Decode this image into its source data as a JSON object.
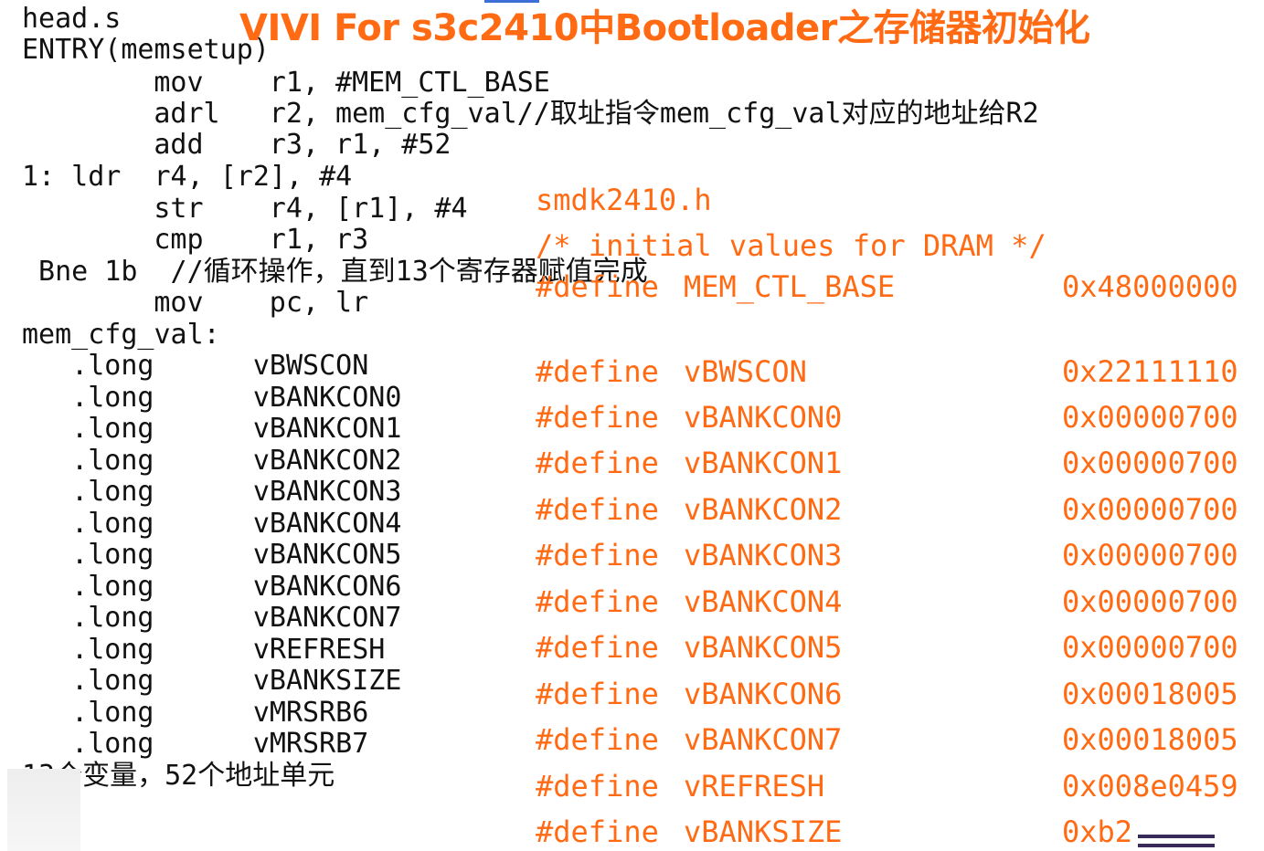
{
  "title": "VIVI For s3c2410中Bootloader之存储器初始化",
  "code_lines": [
    "head.s",
    "ENTRY(memsetup)",
    "      mov    r1, #MEM_CTL_BASE",
    "      adrl   r2, mem_cfg_val//取址指令mem_cfg_val对应的地址给R2",
    "      add    r3, r1, #52",
    "1: ldr  r4, [r2], #4",
    "      str    r4, [r1], #4",
    "      cmp    r1, r3",
    " Bne 1b  //循环操作，直到13个寄存器赋值完成",
    "      mov    pc, lr",
    "mem_cfg_val:",
    "   .long      vBWSCON",
    "   .long      vBANKCON0",
    "   .long      vBANKCON1",
    "   .long      vBANKCON2",
    "   .long      vBANKCON3",
    "   .long      vBANKCON4",
    "   .long      vBANKCON5",
    "   .long      vBANKCON6",
    "   .long      vBANKCON7",
    "   .long      vREFRESH",
    "   .long      vBANKSIZE",
    "   .long      vMRSRB6",
    "   .long      vMRSRB7",
    "13个变量，52个地址单元"
  ],
  "header_file": "smdk2410.h",
  "comment": "/* initial values for DRAM */",
  "defines": [
    {
      "directive": "#define",
      "name": "MEM_CTL_BASE",
      "value": "0x48000000"
    },
    {
      "directive": "#define",
      "name": "vBWSCON",
      "value": "0x22111110"
    },
    {
      "directive": "#define",
      "name": "vBANKCON0",
      "value": "0x00000700"
    },
    {
      "directive": "#define",
      "name": "vBANKCON1",
      "value": "0x00000700"
    },
    {
      "directive": "#define",
      "name": "vBANKCON2",
      "value": "0x00000700"
    },
    {
      "directive": "#define",
      "name": "vBANKCON3",
      "value": "0x00000700"
    },
    {
      "directive": "#define",
      "name": "vBANKCON4",
      "value": "0x00000700"
    },
    {
      "directive": "#define",
      "name": "vBANKCON5",
      "value": "0x00000700"
    },
    {
      "directive": "#define",
      "name": "vBANKCON6",
      "value": "0x00018005"
    },
    {
      "directive": "#define",
      "name": "vBANKCON7",
      "value": "0x00018005"
    },
    {
      "directive": "#define",
      "name": "vREFRESH",
      "value": "0x008e0459"
    },
    {
      "directive": "#define",
      "name": "vBANKSIZE",
      "value": "0xb2"
    }
  ],
  "colors": {
    "accent": "#ff6a13",
    "text": "#111111"
  }
}
